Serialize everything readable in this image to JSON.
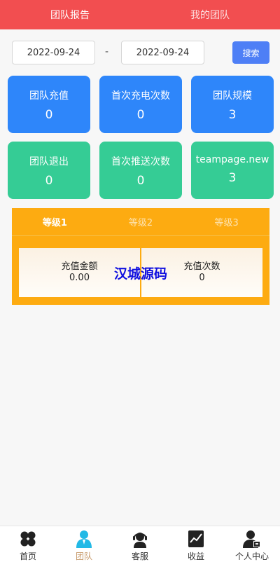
{
  "top_tabs": [
    {
      "label": "团队报告"
    },
    {
      "label": "我的团队"
    }
  ],
  "filter": {
    "start_date": "2022-09-24",
    "separator": "-",
    "end_date": "2022-09-24",
    "search_label": "搜索"
  },
  "stats": [
    {
      "label": "团队充值",
      "value": "0"
    },
    {
      "label": "首次充电次数",
      "value": "0"
    },
    {
      "label": "团队规模",
      "value": "3"
    },
    {
      "label": "团队退出",
      "value": "0"
    },
    {
      "label": "首次推送次数",
      "value": "0"
    },
    {
      "label": "teampage.new",
      "value": "3"
    }
  ],
  "levels": {
    "tabs": [
      {
        "label": "等级1"
      },
      {
        "label": "等级2"
      },
      {
        "label": "等级3"
      }
    ],
    "recharge_amount_label": "充值金额",
    "recharge_amount_value": "0.00",
    "recharge_count_label": "充值次数",
    "recharge_count_value": "0",
    "watermark": "汉城源码"
  },
  "bottom_nav": [
    {
      "label": "首页",
      "icon": "home-icon"
    },
    {
      "label": "团队",
      "icon": "team-icon"
    },
    {
      "label": "客服",
      "icon": "support-icon"
    },
    {
      "label": "收益",
      "icon": "earnings-icon"
    },
    {
      "label": "个人中心",
      "icon": "profile-icon"
    }
  ],
  "colors": {
    "header": "#f24e50",
    "primary_blue": "#2e86fa",
    "green": "#35cc95",
    "orange": "#fdab11",
    "search_button": "#4e7ff6",
    "active_nav": "#c79a6b"
  }
}
